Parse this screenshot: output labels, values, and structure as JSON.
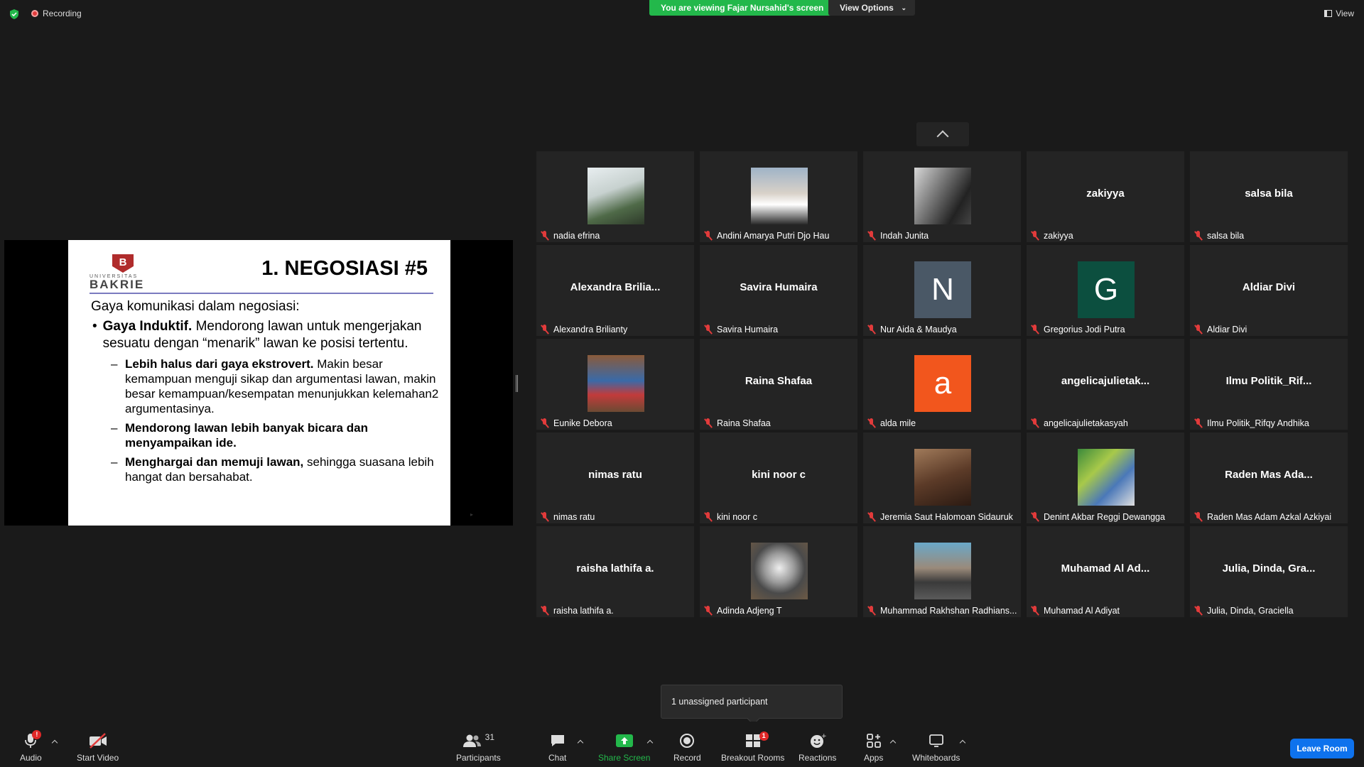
{
  "top": {
    "recording_label": "Recording",
    "viewing_banner": "You are viewing Fajar Nursahid's screen",
    "view_options": "View Options",
    "view_label": "View"
  },
  "slide": {
    "logo_top": "UNIVERSITAS",
    "logo_bottom": "BAKRIE",
    "title": "1. NEGOSIASI #5",
    "intro": "Gaya komunikasi dalam negosiasi:",
    "bullet_bold": "Gaya Induktif.",
    "bullet_rest": " Mendorong lawan untuk mengerjakan sesuatu dengan “menarik” lawan ke posisi tertentu.",
    "subs": [
      {
        "bold": "Lebih halus dari gaya ekstrovert.",
        "rest": " Makin besar kemampuan menguji sikap dan argumentasi lawan, makin besar kemampuan/kesempatan menunjukkan kelemahan2 argumentasinya."
      },
      {
        "bold": "Mendorong lawan lebih banyak bicara dan menyampaikan ide.",
        "rest": ""
      },
      {
        "bold": "Menghargai dan memuji lawan,",
        "rest": " sehingga suasana lebih hangat dan bersahabat."
      }
    ]
  },
  "participants": [
    {
      "name": "nadia efrina",
      "type": "photo",
      "photo": "outdoor-person",
      "label": ""
    },
    {
      "name": "Andini Amarya Putri Djo Hau",
      "type": "photo",
      "photo": "two-people",
      "label": ""
    },
    {
      "name": "Indah Junita",
      "type": "photo",
      "photo": "dark-portrait",
      "label": ""
    },
    {
      "name": "zakiyya",
      "type": "text",
      "label": "zakiyya"
    },
    {
      "name": "salsa bila",
      "type": "text",
      "label": "salsa bila"
    },
    {
      "name": "Alexandra Brilianty",
      "type": "text",
      "label": "Alexandra  Brilia..."
    },
    {
      "name": "Savira Humaira",
      "type": "text",
      "label": "Savira Humaira"
    },
    {
      "name": "Nur Aida & Maudya",
      "type": "initial",
      "label": "N",
      "color": "#4a5866"
    },
    {
      "name": "Gregorius Jodi Putra",
      "type": "initial",
      "label": "G",
      "color": "#0c4f3f"
    },
    {
      "name": "Aldiar Divi",
      "type": "text",
      "label": "Aldiar Divi"
    },
    {
      "name": "Eunike Debora",
      "type": "photo",
      "photo": "cartoon-character",
      "label": ""
    },
    {
      "name": "Raina Shafaa",
      "type": "text",
      "label": "Raina Shafaa"
    },
    {
      "name": "alda mile",
      "type": "initial",
      "label": "a",
      "color": "#f2561d"
    },
    {
      "name": "angelicajulietakasyah",
      "type": "text",
      "label": "angelicajulietak..."
    },
    {
      "name": "Ilmu Politik_Rifqy Andhika",
      "type": "text",
      "label": "Ilmu  Politik_Rif..."
    },
    {
      "name": "nimas ratu",
      "type": "text",
      "label": "nimas ratu"
    },
    {
      "name": "kini noor c",
      "type": "text",
      "label": "kini noor c"
    },
    {
      "name": "Jeremia Saut Halomoan Sidauruk",
      "type": "photo",
      "photo": "vintage-portrait",
      "label": ""
    },
    {
      "name": "Denint Akbar Reggi Dewangga",
      "type": "photo",
      "photo": "cartoon-collage",
      "label": ""
    },
    {
      "name": "Raden Mas Adam Azkal Azkiyai",
      "type": "text",
      "label": "Raden  Mas  Ada..."
    },
    {
      "name": "raisha lathifa a.",
      "type": "text",
      "label": "raisha lathifa a."
    },
    {
      "name": "Adinda Adjeng T",
      "type": "photo",
      "photo": "cooking-pot",
      "label": ""
    },
    {
      "name": "Muhammad Rakhshan Radhians...",
      "type": "photo",
      "photo": "motorbike-rider",
      "label": ""
    },
    {
      "name": "Muhamad Al Adiyat",
      "type": "text",
      "label": "Muhamad  Al  Ad..."
    },
    {
      "name": "Julia, Dinda, Graciella",
      "type": "text",
      "label": "Julia,  Dinda,  Gra..."
    }
  ],
  "popup": "1 unassigned participant",
  "toolbar": {
    "audio": "Audio",
    "audio_badge": "!",
    "video": "Start Video",
    "participants": "Participants",
    "participants_count": "31",
    "chat": "Chat",
    "share": "Share Screen",
    "record": "Record",
    "breakout": "Breakout Rooms",
    "breakout_badge": "1",
    "reactions": "Reactions",
    "apps": "Apps",
    "whiteboards": "Whiteboards",
    "leave": "Leave Room"
  },
  "colors": {
    "green": "#23b84b",
    "blue": "#0e72ed",
    "red": "#e02828",
    "tile": "#242424"
  }
}
